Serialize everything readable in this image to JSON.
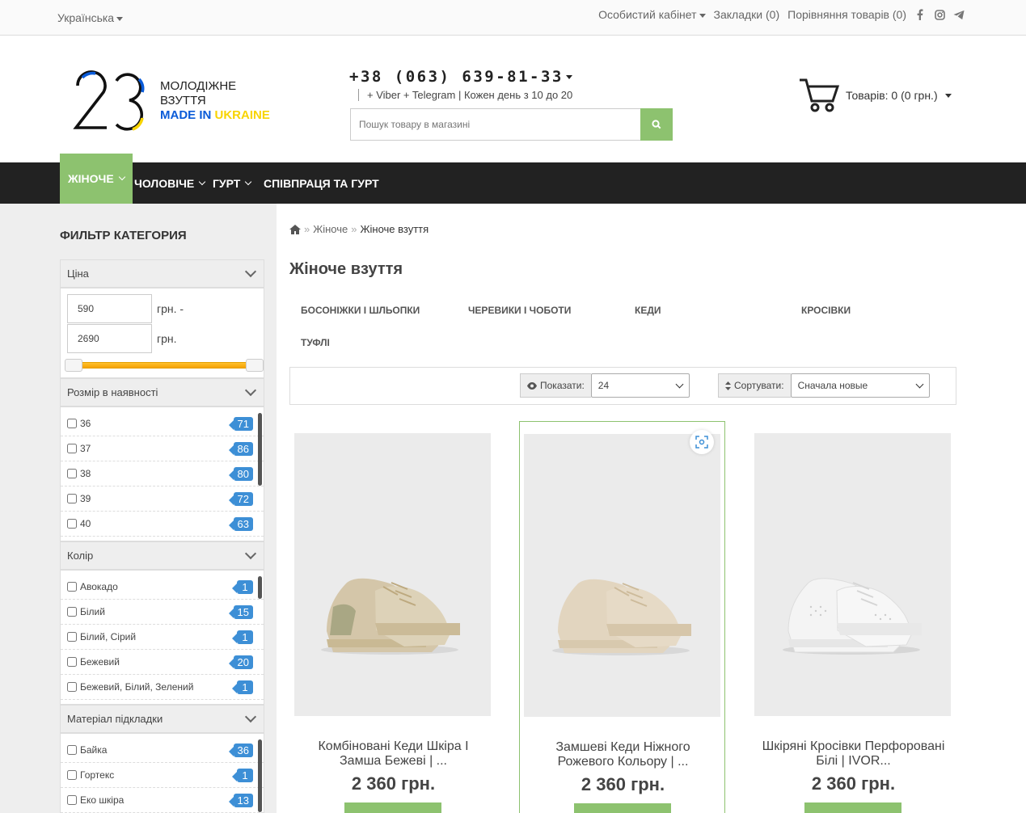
{
  "topbar": {
    "language": "Українська",
    "account": "Особистий кабінет",
    "bookmarks": "Закладки (0)",
    "compare": "Порівняння товарів (0)"
  },
  "logo": {
    "number": "23",
    "line1": "МОЛОДІЖНЕ",
    "line2": "ВЗУТТЯ",
    "line3a": "MADE IN ",
    "line3b": "UKRAINE"
  },
  "contact": {
    "phone": "+38 (063) 639-81-33",
    "sub": "+ Viber + Telegram | Кожен день з 10 до 20"
  },
  "search": {
    "placeholder": "Пошук товару в магазині"
  },
  "cart": {
    "label": "Товарів: 0 (0 грн.)"
  },
  "nav": [
    {
      "label": "Жіноче"
    },
    {
      "label": "Чоловіче"
    },
    {
      "label": "Гурт"
    },
    {
      "label": "Співпраця та гурт"
    }
  ],
  "filter": {
    "title": "Фильтр категория",
    "price": {
      "header": "Ціна",
      "min": "590",
      "max": "2690",
      "unit_from": "грн. -",
      "unit_to": "грн.",
      "range_min_fraction": 0,
      "range_max_fraction": 1
    },
    "size": {
      "header": "Розмір в наявності",
      "items": [
        {
          "label": "36",
          "count": "71"
        },
        {
          "label": "37",
          "count": "86"
        },
        {
          "label": "38",
          "count": "80"
        },
        {
          "label": "39",
          "count": "72"
        },
        {
          "label": "40",
          "count": "63"
        }
      ]
    },
    "color": {
      "header": "Колір",
      "items": [
        {
          "label": "Авокадо",
          "count": "1"
        },
        {
          "label": "Білий",
          "count": "15"
        },
        {
          "label": "Білий, Сірий",
          "count": "1"
        },
        {
          "label": "Бежевий",
          "count": "20"
        },
        {
          "label": "Бежевий, Білий, Зелений",
          "count": "1"
        }
      ]
    },
    "lining": {
      "header": "Матеріал підкладки",
      "items": [
        {
          "label": "Байка",
          "count": "36"
        },
        {
          "label": "Гортекс",
          "count": "1"
        },
        {
          "label": "Еко шкіра",
          "count": "13"
        }
      ]
    }
  },
  "breadcrumb": {
    "item1": "Жіноче",
    "item2": "Жіноче взуття",
    "sep": "»"
  },
  "page_title": "Жіноче взуття",
  "subcategories": [
    "Босоніжки і шльопки",
    "Черевики і чоботи",
    "Кеди",
    "Кросівки",
    "Туфлі"
  ],
  "toolbar": {
    "show_label": "Показати:",
    "show_value": "24",
    "sort_label": "Сортувати:",
    "sort_value": "Сначала новые"
  },
  "products": [
    {
      "name": "Комбіновані Кеди Шкіра І Замша Бежеві | ...",
      "price": "2 360 грн."
    },
    {
      "name": "Замшеві Кеди Ніжного Рожевого Кольору | ...",
      "price": "2 360 грн."
    },
    {
      "name": "Шкіряні Кросівки Перфоровані Білі | IVOR...",
      "price": "2 360 грн."
    }
  ],
  "colors": {
    "accent": "#8dc26f",
    "nav_bg": "#222222",
    "badge": "#3d8fd6",
    "slider": "#f5a200",
    "logo_blue": "#0a5bd8",
    "logo_yellow": "#f8d400"
  }
}
